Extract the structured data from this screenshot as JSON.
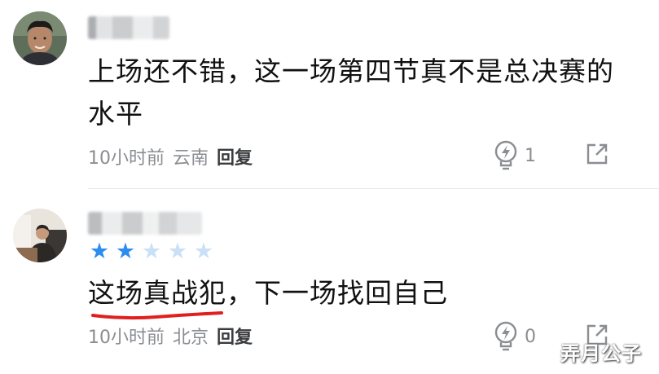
{
  "comments": [
    {
      "avatar_icon": "user-avatar-photo",
      "text_line1": "上场还不错，这一场第四节真不是总决赛的",
      "text_line2": "水平",
      "time": "10小时前",
      "location": "云南",
      "reply_label": "回复",
      "like_count": "1",
      "like_icon": "lightning-bulb-icon",
      "share_icon": "share-arrow-icon"
    },
    {
      "avatar_icon": "user-avatar-photo",
      "rating": 2,
      "rating_max": 5,
      "text": "这场真战犯，下一场找回自己",
      "time": "10小时前",
      "location": "北京",
      "reply_label": "回复",
      "like_count": "0",
      "like_icon": "lightning-bulb-icon",
      "share_icon": "share-arrow-icon"
    }
  ],
  "watermark": "弄月公子",
  "colors": {
    "star_active": "#2d8cf0",
    "star_inactive": "#c9e0f7",
    "underline": "#e02020",
    "meta_text": "#8a8d91"
  }
}
